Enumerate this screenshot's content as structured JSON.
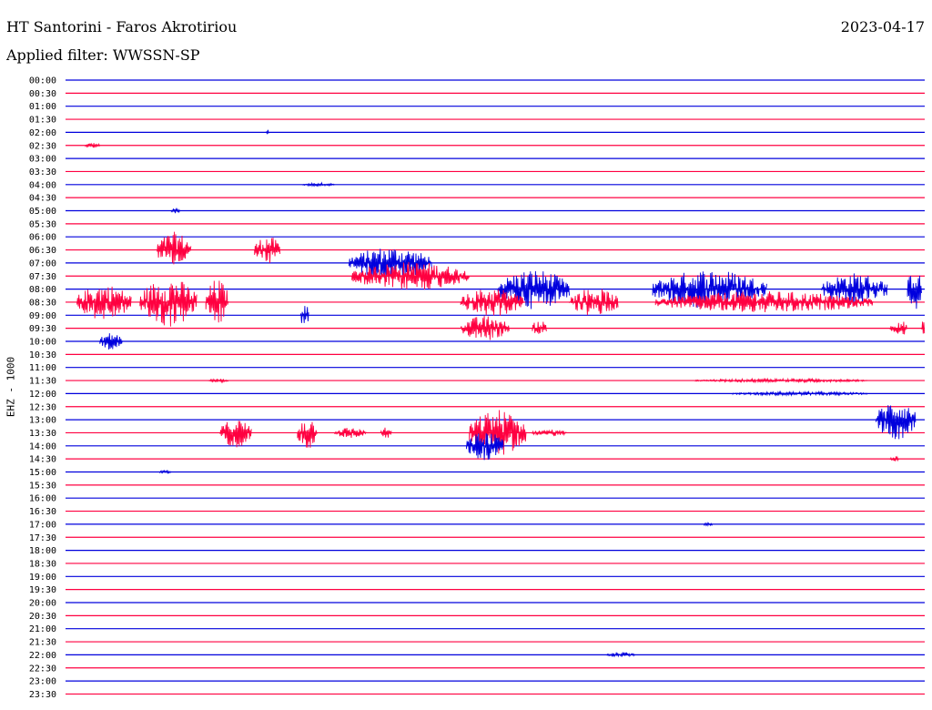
{
  "header": {
    "station": "HT Santorini - Faros Akrotiriou",
    "date": "2023-04-17",
    "filter": "Applied filter: WWSSN-SP"
  },
  "chart_data": {
    "type": "line",
    "ylabel": "EHZ - 1000",
    "row_labels": [
      "00:00",
      "00:30",
      "01:00",
      "01:30",
      "02:00",
      "02:30",
      "03:00",
      "03:30",
      "04:00",
      "04:30",
      "05:00",
      "05:30",
      "06:00",
      "06:30",
      "07:00",
      "07:30",
      "08:00",
      "08:30",
      "09:00",
      "09:30",
      "10:00",
      "10:30",
      "11:00",
      "11:30",
      "12:00",
      "12:30",
      "13:00",
      "13:30",
      "14:00",
      "14:30",
      "15:00",
      "15:30",
      "16:00",
      "16:30",
      "17:00",
      "17:30",
      "18:00",
      "18:30",
      "19:00",
      "19:30",
      "20:00",
      "20:30",
      "21:00",
      "21:30",
      "22:00",
      "22:30",
      "23:00",
      "23:30"
    ],
    "colors": {
      "even_rows": "#0000dd",
      "odd_rows": "#ff0040"
    },
    "x_range_minutes": [
      0,
      30
    ],
    "bursts": [
      {
        "row": 4,
        "start": 7.0,
        "end": 7.1,
        "amp": 3
      },
      {
        "row": 5,
        "start": 0.7,
        "end": 1.2,
        "amp": 3
      },
      {
        "row": 8,
        "start": 8.3,
        "end": 9.4,
        "amp": 2
      },
      {
        "row": 10,
        "start": 3.7,
        "end": 4.0,
        "amp": 3
      },
      {
        "row": 13,
        "start": 3.2,
        "end": 4.4,
        "amp": 20
      },
      {
        "row": 13,
        "start": 6.6,
        "end": 7.5,
        "amp": 16
      },
      {
        "row": 14,
        "start": 9.9,
        "end": 12.8,
        "amp": 18
      },
      {
        "row": 15,
        "start": 10.0,
        "end": 14.1,
        "amp": 16
      },
      {
        "row": 16,
        "start": 15.1,
        "end": 17.6,
        "amp": 22
      },
      {
        "row": 16,
        "start": 20.5,
        "end": 24.5,
        "amp": 22
      },
      {
        "row": 16,
        "start": 26.4,
        "end": 28.7,
        "amp": 18
      },
      {
        "row": 16,
        "start": 29.4,
        "end": 29.9,
        "amp": 24
      },
      {
        "row": 17,
        "start": 0.4,
        "end": 2.3,
        "amp": 20
      },
      {
        "row": 17,
        "start": 2.6,
        "end": 4.6,
        "amp": 28
      },
      {
        "row": 17,
        "start": 4.9,
        "end": 5.7,
        "amp": 26
      },
      {
        "row": 17,
        "start": 13.8,
        "end": 16.0,
        "amp": 16
      },
      {
        "row": 17,
        "start": 17.6,
        "end": 19.3,
        "amp": 16
      },
      {
        "row": 17,
        "start": 20.6,
        "end": 28.2,
        "amp": 12
      },
      {
        "row": 18,
        "start": 8.2,
        "end": 8.5,
        "amp": 14
      },
      {
        "row": 19,
        "start": 13.8,
        "end": 15.5,
        "amp": 14
      },
      {
        "row": 19,
        "start": 16.3,
        "end": 16.8,
        "amp": 10
      },
      {
        "row": 19,
        "start": 28.8,
        "end": 29.4,
        "amp": 10
      },
      {
        "row": 19,
        "start": 29.9,
        "end": 30.0,
        "amp": 10
      },
      {
        "row": 20,
        "start": 1.2,
        "end": 2.0,
        "amp": 10
      },
      {
        "row": 23,
        "start": 5.0,
        "end": 5.7,
        "amp": 2
      },
      {
        "row": 23,
        "start": 22.0,
        "end": 28.0,
        "amp": 2
      },
      {
        "row": 24,
        "start": 23.3,
        "end": 28.0,
        "amp": 2
      },
      {
        "row": 26,
        "start": 28.3,
        "end": 29.7,
        "amp": 22
      },
      {
        "row": 27,
        "start": 5.4,
        "end": 6.5,
        "amp": 16
      },
      {
        "row": 27,
        "start": 8.1,
        "end": 8.8,
        "amp": 18
      },
      {
        "row": 27,
        "start": 9.4,
        "end": 10.5,
        "amp": 6
      },
      {
        "row": 27,
        "start": 11.0,
        "end": 11.4,
        "amp": 6
      },
      {
        "row": 27,
        "start": 14.1,
        "end": 16.1,
        "amp": 26
      },
      {
        "row": 27,
        "start": 16.3,
        "end": 17.5,
        "amp": 4
      },
      {
        "row": 28,
        "start": 14.0,
        "end": 15.3,
        "amp": 16
      },
      {
        "row": 29,
        "start": 28.8,
        "end": 29.1,
        "amp": 3
      },
      {
        "row": 30,
        "start": 3.3,
        "end": 3.7,
        "amp": 2
      },
      {
        "row": 34,
        "start": 22.3,
        "end": 22.6,
        "amp": 2
      },
      {
        "row": 44,
        "start": 18.9,
        "end": 19.9,
        "amp": 3
      }
    ]
  }
}
